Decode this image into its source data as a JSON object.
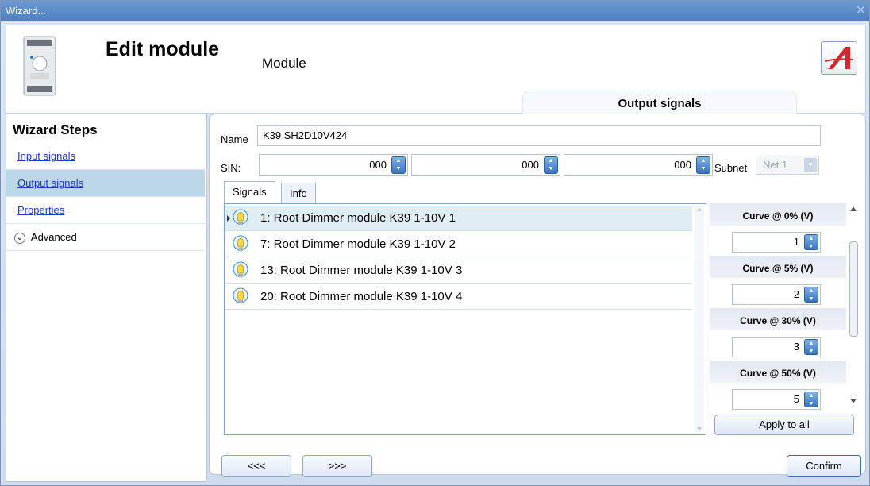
{
  "window": {
    "title": "Wizard..."
  },
  "header": {
    "title": "Edit module",
    "subtitle": "Module",
    "section_tab": "Output signals"
  },
  "steps": {
    "title": "Wizard Steps",
    "items": [
      {
        "label": "Input signals"
      },
      {
        "label": "Output signals"
      },
      {
        "label": "Properties"
      }
    ],
    "advanced": "Advanced"
  },
  "form": {
    "name_label": "Name",
    "name_value": "K39 SH2D10V424",
    "sin_label": "SIN:",
    "sin_values": [
      "000",
      "000",
      "000"
    ],
    "subnet_label": "Subnet",
    "subnet_value": "Net 1"
  },
  "tabs": [
    {
      "label": "Signals"
    },
    {
      "label": "Info"
    }
  ],
  "signals": [
    {
      "label": "1: Root Dimmer module K39 1-10V 1"
    },
    {
      "label": "7: Root Dimmer module K39 1-10V 2"
    },
    {
      "label": "13: Root Dimmer module K39 1-10V 3"
    },
    {
      "label": "20: Root Dimmer module K39 1-10V 4"
    }
  ],
  "curves": [
    {
      "label": "Curve @ 0% (V)",
      "value": "1"
    },
    {
      "label": "Curve @ 5% (V)",
      "value": "2"
    },
    {
      "label": "Curve @ 30% (V)",
      "value": "3"
    },
    {
      "label": "Curve @ 50% (V)",
      "value": "5"
    }
  ],
  "buttons": {
    "apply_all": "Apply to all",
    "back": "<<<",
    "next": ">>>",
    "confirm": "Confirm"
  },
  "colors": {
    "titlebar": "#5b8ccc",
    "link": "#1f39c9",
    "selected_step": "#bcd7e7",
    "spin_button": "#3a73c2"
  }
}
